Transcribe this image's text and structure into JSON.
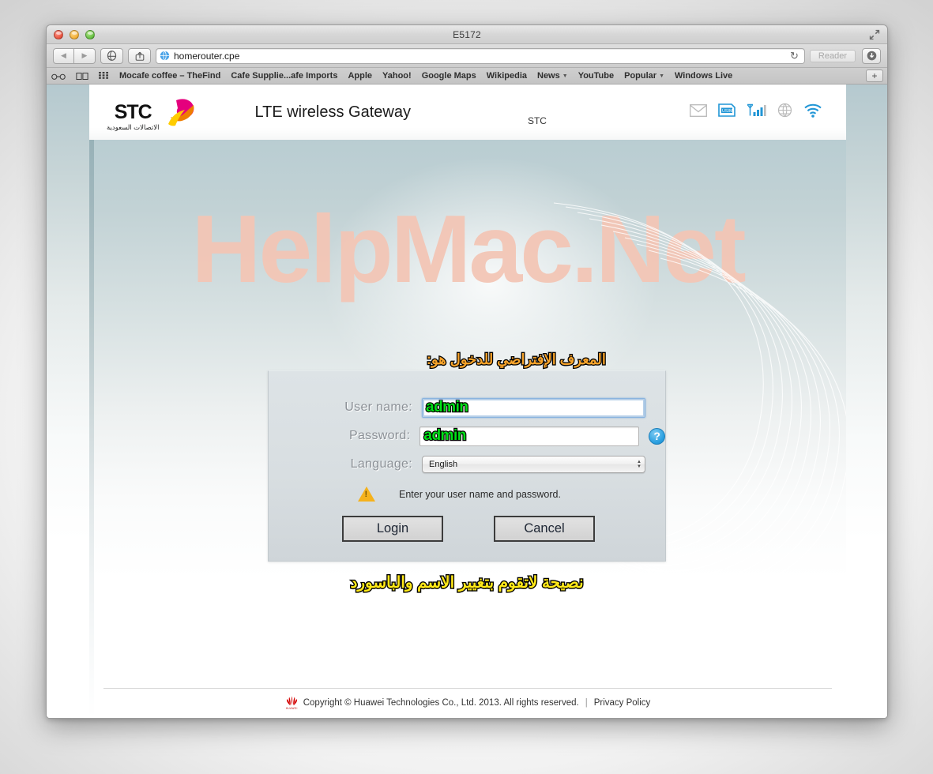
{
  "window": {
    "title": "E5172",
    "traffic_lights": [
      "close",
      "minimize",
      "zoom"
    ],
    "fullscreen_icon": "fullscreen-icon"
  },
  "toolbar": {
    "back_label": "◀",
    "forward_label": "▶",
    "history_icon": "safari-compass-icon",
    "share_icon": "share-icon",
    "url": "homerouter.cpe",
    "site_icon": "globe-favicon",
    "reload_icon": "↻",
    "reader_label": "Reader",
    "downloads_icon": "downloads-icon"
  },
  "bookmarks": {
    "icons": [
      "reading-glasses-icon",
      "book-icon",
      "top-sites-icon"
    ],
    "items": [
      {
        "label": "Mocafe coffee – TheFind",
        "has_caret": false
      },
      {
        "label": "Cafe Supplie...afe Imports",
        "has_caret": false
      },
      {
        "label": "Apple",
        "has_caret": false
      },
      {
        "label": "Yahoo!",
        "has_caret": false
      },
      {
        "label": "Google Maps",
        "has_caret": false
      },
      {
        "label": "Wikipedia",
        "has_caret": false
      },
      {
        "label": "News",
        "has_caret": true
      },
      {
        "label": "YouTube",
        "has_caret": false
      },
      {
        "label": "Popular",
        "has_caret": true
      },
      {
        "label": "Windows Live",
        "has_caret": false
      }
    ],
    "add_label": "+"
  },
  "router_header": {
    "brand_latin": "STC",
    "brand_arabic": "الاتصالات السعودية",
    "gateway_title": "LTE wireless Gateway",
    "carrier": "STC",
    "status_icons": [
      {
        "name": "mail-icon",
        "color": "#b9b9b9"
      },
      {
        "name": "usim-icon",
        "color": "#2196d6"
      },
      {
        "name": "signal-bars-icon",
        "color": "#2196d6"
      },
      {
        "name": "globe-icon",
        "color": "#b9b9b9"
      },
      {
        "name": "wifi-icon",
        "color": "#2196d6"
      }
    ]
  },
  "watermark": {
    "text": "HelpMac.Net",
    "color": "#f3c6b6"
  },
  "login": {
    "annotation_top": "المعرف الإفتراضي للدخول هو:",
    "annotation_top_color": "#f7a32a",
    "annotation_bottom": "نصيحة لاتقوم بتغيير الاسم والباسورد",
    "annotation_bottom_color": "#ffe818",
    "username_label": "User name:",
    "username_value": "admin",
    "password_label": "Password:",
    "password_value": "admin",
    "annotation_value_color": "#00e017",
    "help_icon": "?",
    "language_label": "Language:",
    "language_value": "English",
    "language_options": [
      "English"
    ],
    "hint_icon": "warning-icon",
    "hint_text": "Enter your user name and password.",
    "login_button": "Login",
    "cancel_button": "Cancel"
  },
  "footer": {
    "logo": "huawei-logo",
    "logo_sub": "HUAWEI",
    "copyright": "Copyright © Huawei Technologies Co., Ltd. 2013. All rights reserved.",
    "separator": "|",
    "privacy_link": "Privacy Policy"
  }
}
